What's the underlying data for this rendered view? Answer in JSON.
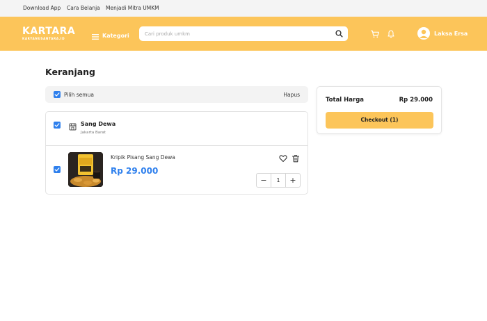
{
  "topbar": {
    "links": [
      "Download App",
      "Cara Belanja",
      "Menjadi Mitra UMKM"
    ]
  },
  "header": {
    "logo_main": "KARTARA",
    "logo_sub": "KARYANUSANTARA.ID",
    "kategori_label": "Kategori",
    "search_placeholder": "Cari produk umkm",
    "user_name": "Laksa Ersa"
  },
  "cart": {
    "title": "Keranjang",
    "select_all_label": "Pilih semua",
    "delete_label": "Hapus",
    "store": {
      "name": "Sang Dewa",
      "location": "Jakarta Barat"
    },
    "item": {
      "name": "Kripik Pisang Sang Dewa",
      "price": "Rp 29.000",
      "quantity": "1",
      "minus": "−",
      "plus": "+"
    }
  },
  "summary": {
    "total_label": "Total Harga",
    "total_value": "Rp 29.000",
    "checkout_label": "Checkout (1)"
  },
  "colors": {
    "brand": "#fcc55a",
    "accent": "#2f80ed"
  }
}
